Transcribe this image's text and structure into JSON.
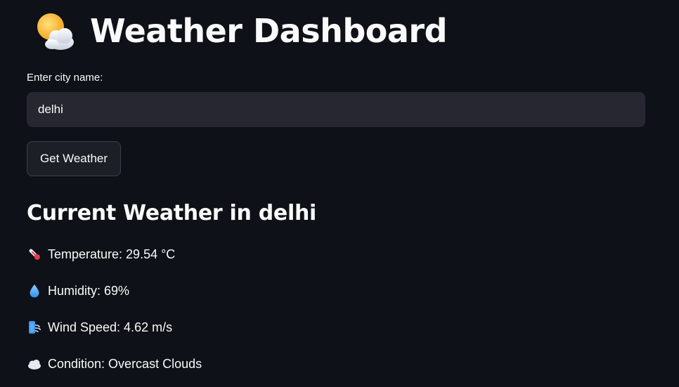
{
  "header": {
    "title": "Weather Dashboard",
    "icon": "sun-behind-cloud-icon"
  },
  "search": {
    "label": "Enter city name:",
    "value": "delhi",
    "placeholder": ""
  },
  "actions": {
    "get_weather_label": "Get Weather"
  },
  "results": {
    "heading": "Current Weather in delhi",
    "metrics": [
      {
        "icon": "thermometer-icon",
        "text": "Temperature: 29.54 °C"
      },
      {
        "icon": "droplet-icon",
        "text": "Humidity: 69%"
      },
      {
        "icon": "wind-icon",
        "text": "Wind Speed: 4.62 m/s"
      },
      {
        "icon": "cloud-icon",
        "text": "Condition: Overcast Clouds"
      }
    ]
  },
  "colors": {
    "background": "#0e1117",
    "input_background": "#262730",
    "text": "#fafafa"
  }
}
